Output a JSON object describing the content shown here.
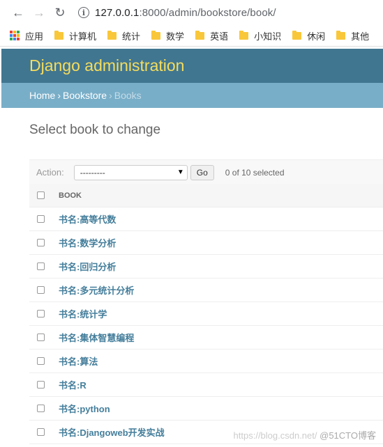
{
  "browser": {
    "url_host": "127.0.0.1",
    "url_path": ":8000/admin/bookstore/book/",
    "bookmarks": [
      {
        "label": "应用",
        "icon": "apps-icon"
      },
      {
        "label": "计算机",
        "icon": "folder-icon"
      },
      {
        "label": "统计",
        "icon": "folder-icon"
      },
      {
        "label": "数学",
        "icon": "folder-icon"
      },
      {
        "label": "英语",
        "icon": "folder-icon"
      },
      {
        "label": "小知识",
        "icon": "folder-icon"
      },
      {
        "label": "休闲",
        "icon": "folder-icon"
      },
      {
        "label": "其他",
        "icon": "folder-icon"
      }
    ]
  },
  "header": {
    "title": "Django administration"
  },
  "breadcrumbs": {
    "home": "Home",
    "app": "Bookstore",
    "current": "Books"
  },
  "page_title": "Select book to change",
  "actions": {
    "label": "Action:",
    "selected": "---------",
    "go": "Go",
    "counter": "0 of 10 selected"
  },
  "table": {
    "column": "BOOK",
    "rows": [
      "书名:高等代数",
      "书名:数学分析",
      "书名:回归分析",
      "书名:多元统计分析",
      "书名:统计学",
      "书名:集体智慧编程",
      "书名:算法",
      "书名:R",
      "书名:python",
      "书名:Djangoweb开发实战"
    ]
  },
  "watermark": {
    "url": "https://blog.csdn.net/",
    "brand": "@51CTO博客"
  },
  "colors": {
    "header": "#417690",
    "breadcrumb": "#79aec8",
    "title": "#f5dd5d",
    "link": "#447e9b"
  }
}
